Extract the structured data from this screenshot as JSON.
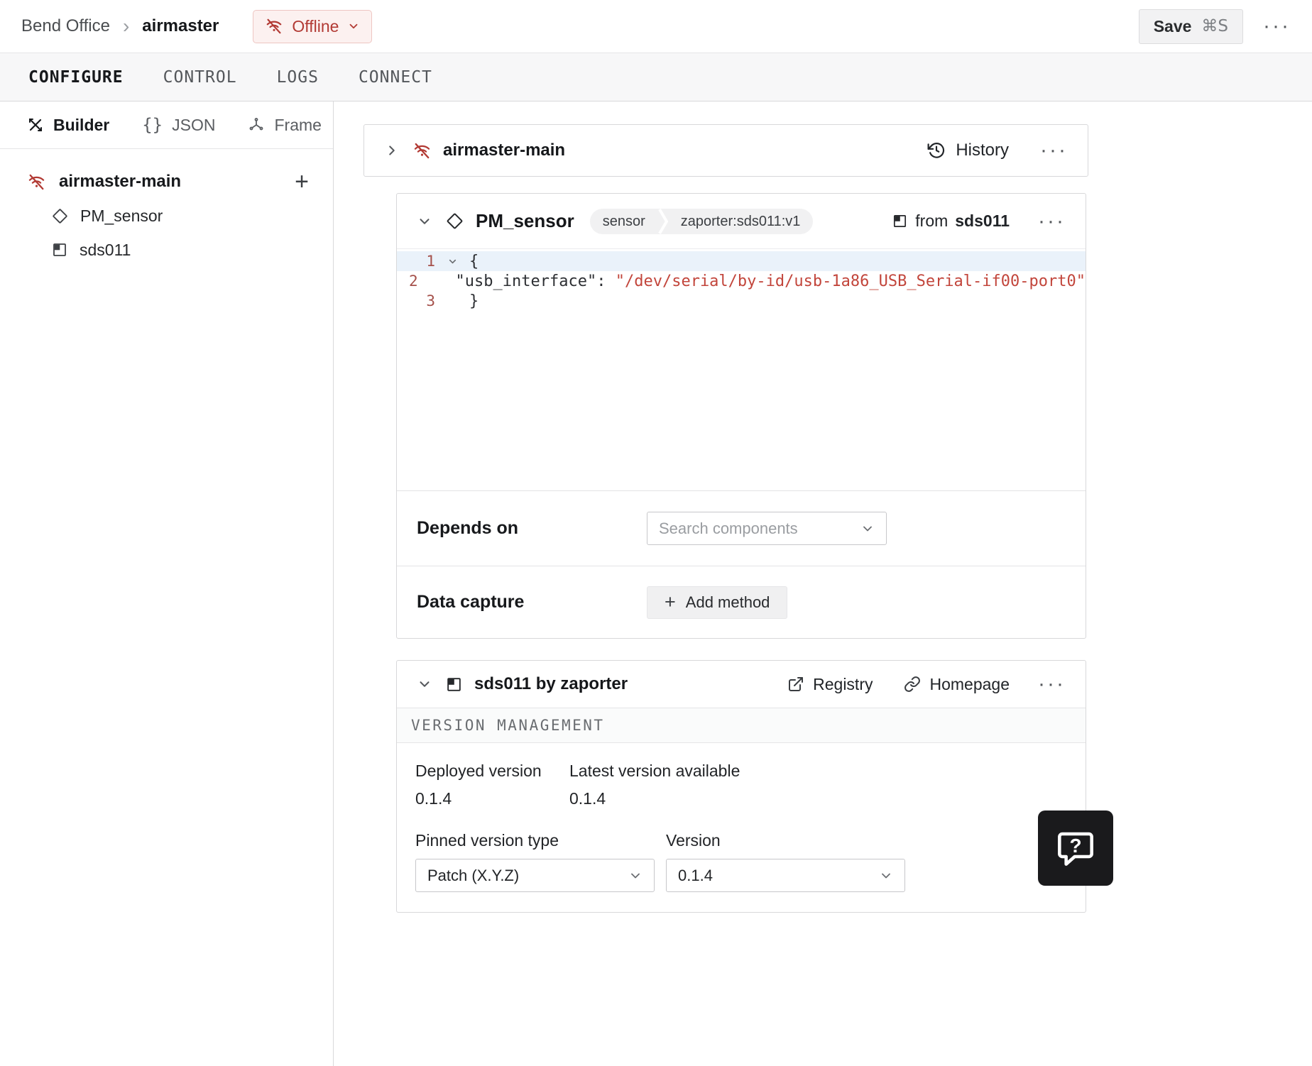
{
  "colors": {
    "accent_red": "#b23a34",
    "code_string_red": "#c2453b",
    "offline_bg": "#fcf1f0",
    "tab_bar_bg": "#f7f7f8"
  },
  "header": {
    "breadcrumb": {
      "parent": "Bend Office",
      "current": "airmaster"
    },
    "status": {
      "label": "Offline"
    },
    "save": {
      "label": "Save",
      "shortcut": "⌘S"
    }
  },
  "tabs": [
    {
      "label": "CONFIGURE"
    },
    {
      "label": "CONTROL"
    },
    {
      "label": "LOGS"
    },
    {
      "label": "CONNECT"
    }
  ],
  "sidebar": {
    "modes": [
      {
        "label": "Builder"
      },
      {
        "label": "JSON"
      },
      {
        "label": "Frame"
      }
    ],
    "tree": {
      "root": "airmaster-main",
      "children": [
        {
          "label": "PM_sensor"
        },
        {
          "label": "sds011"
        }
      ]
    }
  },
  "main": {
    "machine_card": {
      "title": "airmaster-main",
      "history_label": "History"
    },
    "component_card": {
      "title": "PM_sensor",
      "badges": [
        "sensor",
        "zaporter:sds011:v1"
      ],
      "from_label": "from",
      "from_name": "sds011",
      "code": {
        "line_numbers": [
          "1",
          "2",
          "3"
        ],
        "line1": "{",
        "line2_key": "  \"usb_interface\": ",
        "line2_value": "\"/dev/serial/by-id/usb-1a86_USB_Serial-if00-port0\"",
        "line3": "}"
      },
      "depends_on": {
        "label": "Depends on",
        "placeholder": "Search components"
      },
      "data_capture": {
        "label": "Data capture",
        "button": "Add method"
      }
    },
    "module_card": {
      "title": "sds011 by zaporter",
      "registry_label": "Registry",
      "homepage_label": "Homepage",
      "section_title": "VERSION MANAGEMENT",
      "deployed": {
        "label": "Deployed version",
        "value": "0.1.4"
      },
      "latest": {
        "label": "Latest version available",
        "value": "0.1.4"
      },
      "pinned": {
        "label": "Pinned version type",
        "value": "Patch (X.Y.Z)"
      },
      "version": {
        "label": "Version",
        "value": "0.1.4"
      }
    }
  }
}
